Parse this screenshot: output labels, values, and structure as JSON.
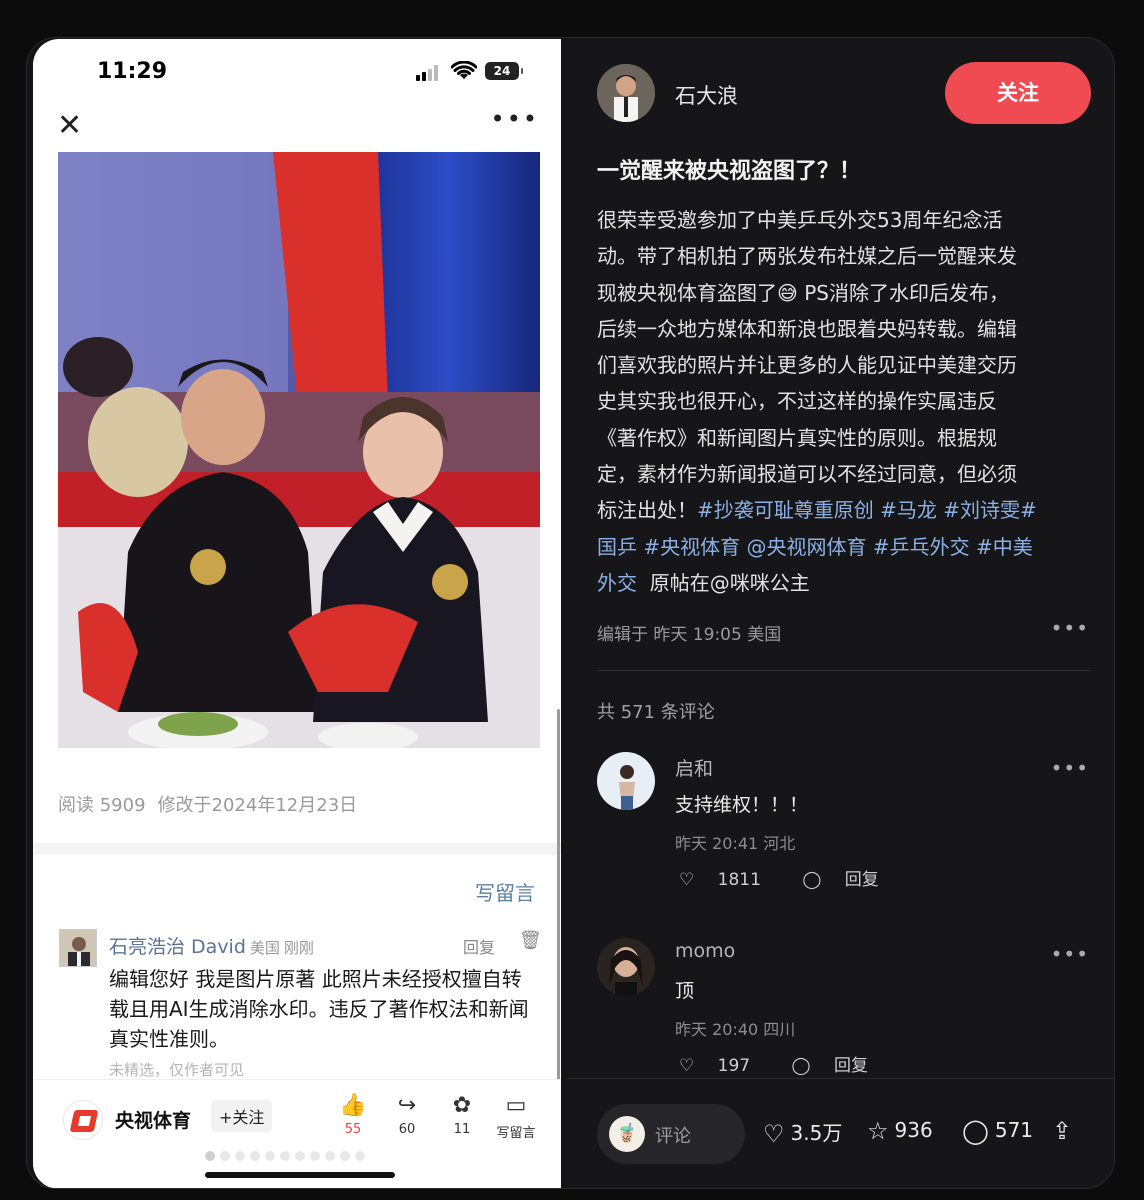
{
  "left": {
    "status": {
      "time": "11:29",
      "battery": "24"
    },
    "meta": {
      "reads": "阅读 5909",
      "modified": "修改于2024年12月23日"
    },
    "write_comment": "写留言",
    "comment": {
      "author": "石亮浩治 David",
      "location": "美国",
      "when": "刚刚",
      "reply": "回复",
      "text": "编辑您好 我是图片原著 此照片未经授权擅自转载且用AI生成消除水印。违反了著作权法和新闻真实性准则。",
      "note": "未精选，仅作者可见"
    },
    "account": {
      "name": "央视体育",
      "follow": "+关注"
    },
    "actions": [
      {
        "icon": "thumbs-up-icon",
        "count": "55"
      },
      {
        "icon": "share-icon",
        "count": "60"
      },
      {
        "icon": "recommend-icon",
        "count": "11"
      },
      {
        "icon": "comment-icon",
        "count": "写留言"
      }
    ]
  },
  "right": {
    "author": "石大浪",
    "follow": "关注",
    "title": "一觉醒来被央视盗图了？！",
    "body_lines": [
      "很荣幸受邀参加了中美乒乓外交53周年纪念活",
      "动。带了相机拍了两张发布社媒之后一觉醒来发",
      "现被央视体育盗图了😅 PS消除了水印后发布，",
      "后续一众地方媒体和新浪也跟着央妈转载。编辑",
      "们喜欢我的照片并让更多的人能见证中美建交历",
      "史其实我也很开心，不过这样的操作实属违反",
      "《著作权》和新闻图片真实性的原则。根据规",
      "定，素材作为新闻报道可以不经过同意，但必须"
    ],
    "body_tail": "标注出处！",
    "tags_line1": "#抄袭可耻尊重原创 #马龙 #刘诗雯#",
    "tags_line2": "国乒 #央视体育 @央视网体育 #乒乓外交 #中美",
    "tags_line3a": "外交",
    "tags_line3b": "原帖在@咪咪公主",
    "edited": "编辑于 昨天 19:05 美国",
    "comment_count": "共 571 条评论",
    "comments": [
      {
        "name": "启和",
        "text": "支持维权！！！",
        "time": "昨天 20:41 河北",
        "likes": "1811",
        "reply": "回复"
      },
      {
        "name": "momo",
        "text": "顶",
        "time": "昨天 20:40 四川",
        "likes": "197",
        "reply": "回复"
      }
    ],
    "bottom": {
      "placeholder": "评论",
      "likes": "3.5万",
      "stars": "936",
      "comments": "571"
    }
  }
}
